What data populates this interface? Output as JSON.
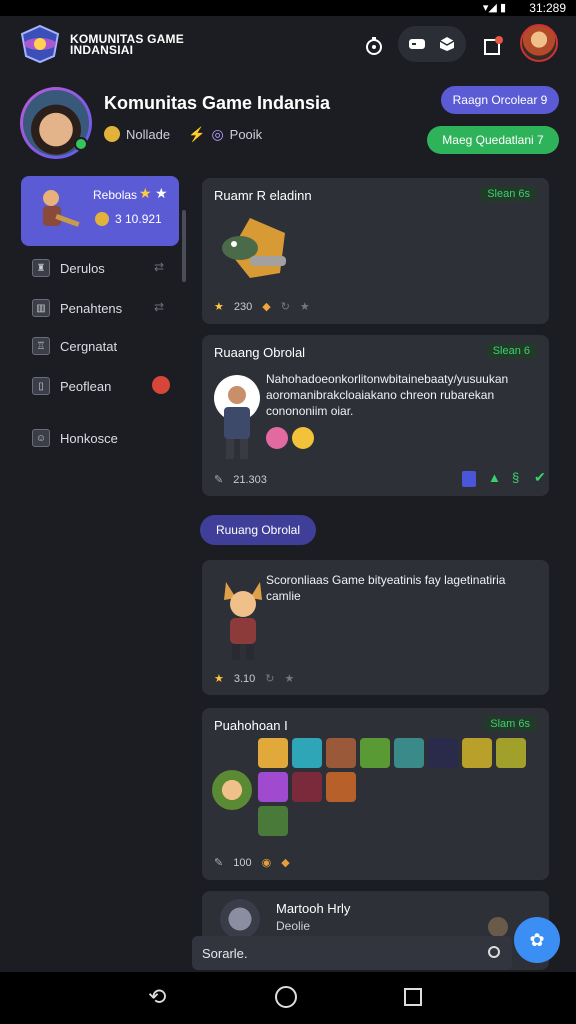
{
  "status_bar": {
    "time": "31:289",
    "signal": "▾◢ ▮"
  },
  "app_bar": {
    "brand_line1": "KOMUNITAS GAME",
    "brand_line2": "INDANSIAI"
  },
  "profile": {
    "title": "Komunitas Game Indansia",
    "meta_1": "Nollade",
    "meta_2": "Pooik",
    "button_1": "Raagn Orcolear 9",
    "button_2": "Maeg Quedatlani 7"
  },
  "sidebar": {
    "card_name": "Rebolas",
    "card_value": "3 10.921",
    "items": [
      {
        "label": "Derulos"
      },
      {
        "label": "Penahtens"
      },
      {
        "label": "Cergnatat"
      },
      {
        "label": "Peoflean"
      },
      {
        "label": "Honkosce"
      }
    ]
  },
  "feed": {
    "card1": {
      "title": "Ruamr R eladinn",
      "tag": "Slean 6s",
      "rating": "230"
    },
    "card2": {
      "title": "Ruaang Obrolal",
      "tag": "Slean 6",
      "text": "Nahohadoeonkorlitonwbitainebaaty/yusuukan aoromanibrakcloaiakano chreon rubarekan conononiim oiar.",
      "count": "21.303"
    },
    "chip": "Ruuang Obrolal",
    "card3": {
      "text": "Scoronliaas Game bityeatinis fay lagetinatiria camlie",
      "rating": "3.10"
    },
    "card4": {
      "title": "Puahohoan I",
      "tag": "Slam 6s",
      "count": "100"
    },
    "card5": {
      "title": "Martooh Hrly",
      "subtitle": "Deolie"
    }
  },
  "search": {
    "value": "Sorarle."
  },
  "colors": {
    "accent": "#5b5bd6",
    "green": "#2fb35a",
    "fab": "#3b8ef3",
    "tag_green": "#3ad16a"
  }
}
